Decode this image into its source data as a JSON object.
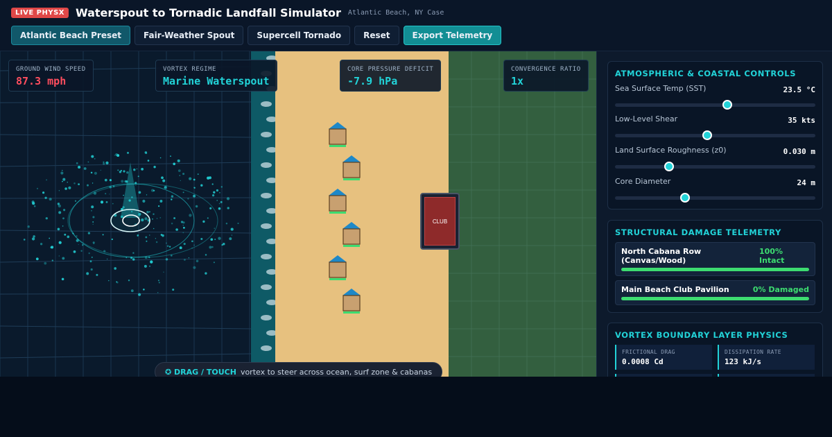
{
  "header": {
    "badge": "LIVE PHYSX",
    "title": "Waterspout to Tornadic Landfall Simulator",
    "subtitle": "Atlantic Beach, NY Case"
  },
  "toolbar": {
    "buttons": [
      {
        "label": "Atlantic Beach Preset",
        "state": "selected"
      },
      {
        "label": "Fair-Weather Spout",
        "state": "normal"
      },
      {
        "label": "Supercell Tornado",
        "state": "normal"
      },
      {
        "label": "Reset",
        "state": "normal"
      },
      {
        "label": "Export Telemetry",
        "state": "accent"
      }
    ]
  },
  "readouts": [
    {
      "label": "GROUND WIND SPEED",
      "value": "87.3 mph",
      "color": "#ff4d5e"
    },
    {
      "label": "VORTEX REGIME",
      "value": "Marine Waterspout",
      "color": "#22d3d8"
    },
    {
      "label": "CORE PRESSURE DEFICIT",
      "value": "-7.9 hPa",
      "color": "#22d3d8"
    },
    {
      "label": "CONVERGENCE RATIO",
      "value": "1x",
      "color": "#22d3d8"
    }
  ],
  "scene": {
    "club_label": "CLUB",
    "hint_strong": "✪ DRAG / TOUCH",
    "hint_text": "vortex to steer across ocean, surf zone & cabanas",
    "colors": {
      "ocean": "#0a1a2c",
      "surf": "#0e5a66",
      "sand": "#e7c17f",
      "grass": "#335f3f",
      "vortex": "#22d3d8"
    }
  },
  "controls": {
    "title": "ATMOSPHERIC & COASTAL CONTROLS",
    "sliders": [
      {
        "label": "Sea Surface Temp (SST)",
        "value": "23.5 °C",
        "fraction": 0.56
      },
      {
        "label": "Low-Level Shear",
        "value": "35 kts",
        "fraction": 0.46
      },
      {
        "label": "Land Surface Roughness (z0)",
        "value": "0.030 m",
        "fraction": 0.27
      },
      {
        "label": "Core Diameter",
        "value": "24 m",
        "fraction": 0.35
      }
    ]
  },
  "damage": {
    "title": "STRUCTURAL DAMAGE TELEMETRY",
    "rows": [
      {
        "name": "North Cabana Row (Canvas/Wood)",
        "status": "100% Intact",
        "integrity": 1.0
      },
      {
        "name": "Main Beach Club Pavilion",
        "status": "0% Damaged",
        "integrity": 1.0
      }
    ]
  },
  "physics": {
    "title": "VORTEX BOUNDARY LAYER PHYSICS",
    "items": [
      {
        "label": "FRICTIONAL DRAG",
        "value": "0.0008 Cd"
      },
      {
        "label": "DISSIPATION RATE",
        "value": "123 kJ/s"
      }
    ]
  }
}
